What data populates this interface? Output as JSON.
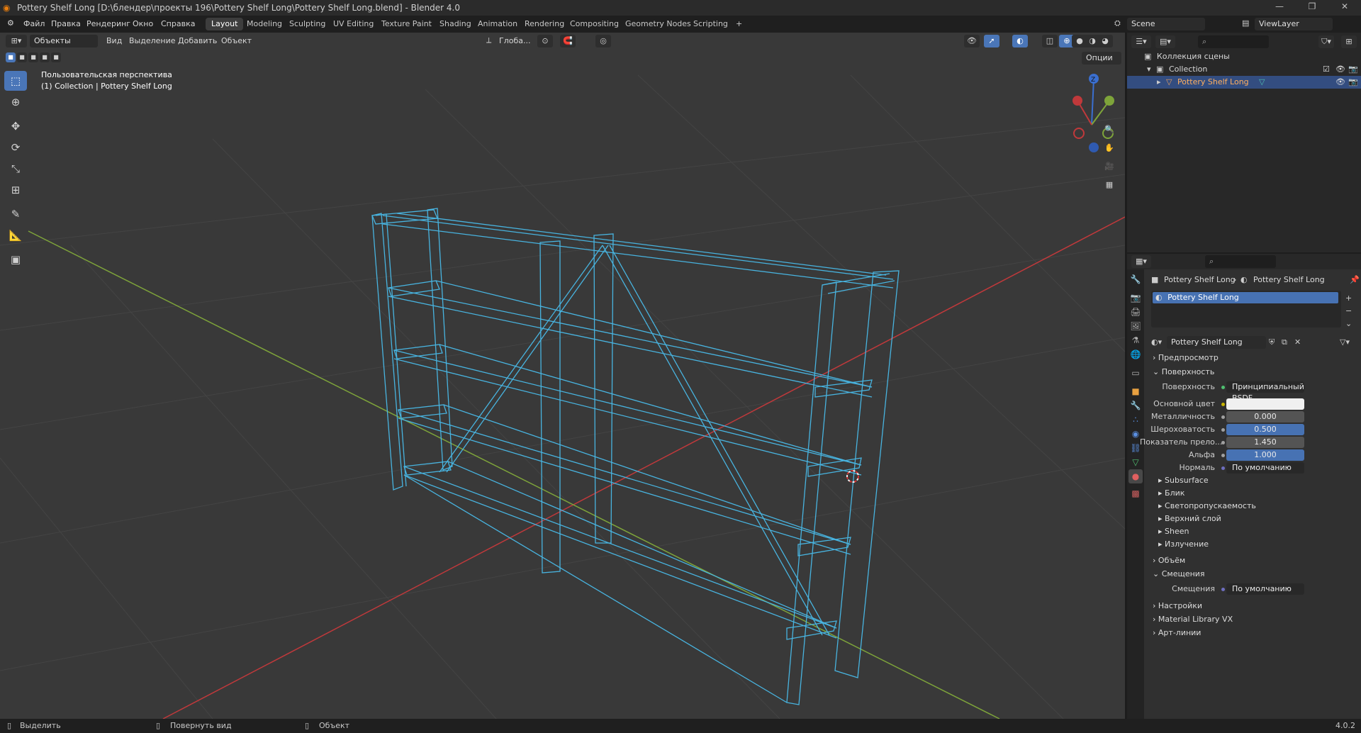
{
  "window": {
    "title": "Pottery Shelf Long [D:\\блендер\\проекты 196\\Pottery Shelf Long\\Pottery Shelf Long.blend] - Blender 4.0",
    "controls": [
      "—",
      "❐",
      "✕"
    ]
  },
  "menu": [
    "Файл",
    "Правка",
    "Рендеринг",
    "Окно",
    "Справка"
  ],
  "workspaces": [
    {
      "label": "Layout",
      "active": true
    },
    {
      "label": "Modeling"
    },
    {
      "label": "Sculpting"
    },
    {
      "label": "UV Editing"
    },
    {
      "label": "Texture Paint"
    },
    {
      "label": "Shading"
    },
    {
      "label": "Animation"
    },
    {
      "label": "Rendering"
    },
    {
      "label": "Compositing"
    },
    {
      "label": "Geometry Nodes"
    },
    {
      "label": "Scripting"
    },
    {
      "label": "+"
    }
  ],
  "scene": {
    "label": "Scene",
    "view_layer": "ViewLayer"
  },
  "viewport": {
    "mode": "Объекты",
    "menus": [
      "Вид",
      "Выделение",
      "Добавить",
      "Объект"
    ],
    "transform_orientation": "Глоба...",
    "options_label": "Опции",
    "info_line1": "Пользовательская перспектива",
    "info_line2": "(1) Collection | Pottery Shelf Long",
    "gizmo": {
      "z": "Z"
    },
    "tools": [
      "select-box",
      "cursor",
      "move",
      "rotate",
      "scale",
      "transform",
      "annotate",
      "measure",
      "add-cube"
    ]
  },
  "outliner": {
    "search_placeholder": "",
    "rows": [
      {
        "label": "Коллекция сцены",
        "indent": 0
      },
      {
        "label": "Collection",
        "indent": 1
      },
      {
        "label": "Pottery Shelf Long",
        "indent": 2,
        "selected": true
      }
    ]
  },
  "properties": {
    "breadcrumb_object": "Pottery Shelf Long",
    "breadcrumb_material": "Pottery Shelf Long",
    "slot": "Pottery Shelf Long",
    "material_name": "Pottery Shelf Long",
    "panels": {
      "preview": "Предпросмотр",
      "surface": "Поверхность",
      "volume": "Объём",
      "displacement": "Смещения",
      "settings": "Настройки",
      "material_library": "Material Library VX",
      "lineart": "Арт-линии"
    },
    "surface_rows": [
      {
        "label": "Поверхность",
        "value": "Принципиальный BSDF",
        "style": "dark",
        "dot": "green"
      },
      {
        "label": "Основной цвет",
        "value": "",
        "style": "white",
        "dot": "yellow"
      },
      {
        "label": "Металличность",
        "value": "0.000",
        "style": "grey",
        "dot": "grey"
      },
      {
        "label": "Шероховатость",
        "value": "0.500",
        "style": "blue",
        "dot": "grey"
      },
      {
        "label": "Показатель прело...",
        "value": "1.450",
        "style": "grey",
        "dot": "grey"
      },
      {
        "label": "Альфа",
        "value": "1.000",
        "style": "blue",
        "dot": "grey"
      },
      {
        "label": "Нормаль",
        "value": "По умолчанию",
        "style": "dark",
        "dot": "purple"
      }
    ],
    "subpanels": [
      "Subsurface",
      "Блик",
      "Светопропускаемость",
      "Верхний слой",
      "Sheen",
      "Излучение"
    ],
    "displacement_row": {
      "label": "Смещения",
      "value": "По умолчанию"
    }
  },
  "statusbar": {
    "select": "Выделить",
    "rotate": "Повернуть вид",
    "object": "Объект",
    "version": "4.0.2"
  },
  "colors": {
    "accent": "#4772b3",
    "wire": "#48b4e0",
    "viewport_bg": "#393939",
    "x_axis": "#c0393b",
    "y_axis": "#7ea43a"
  }
}
